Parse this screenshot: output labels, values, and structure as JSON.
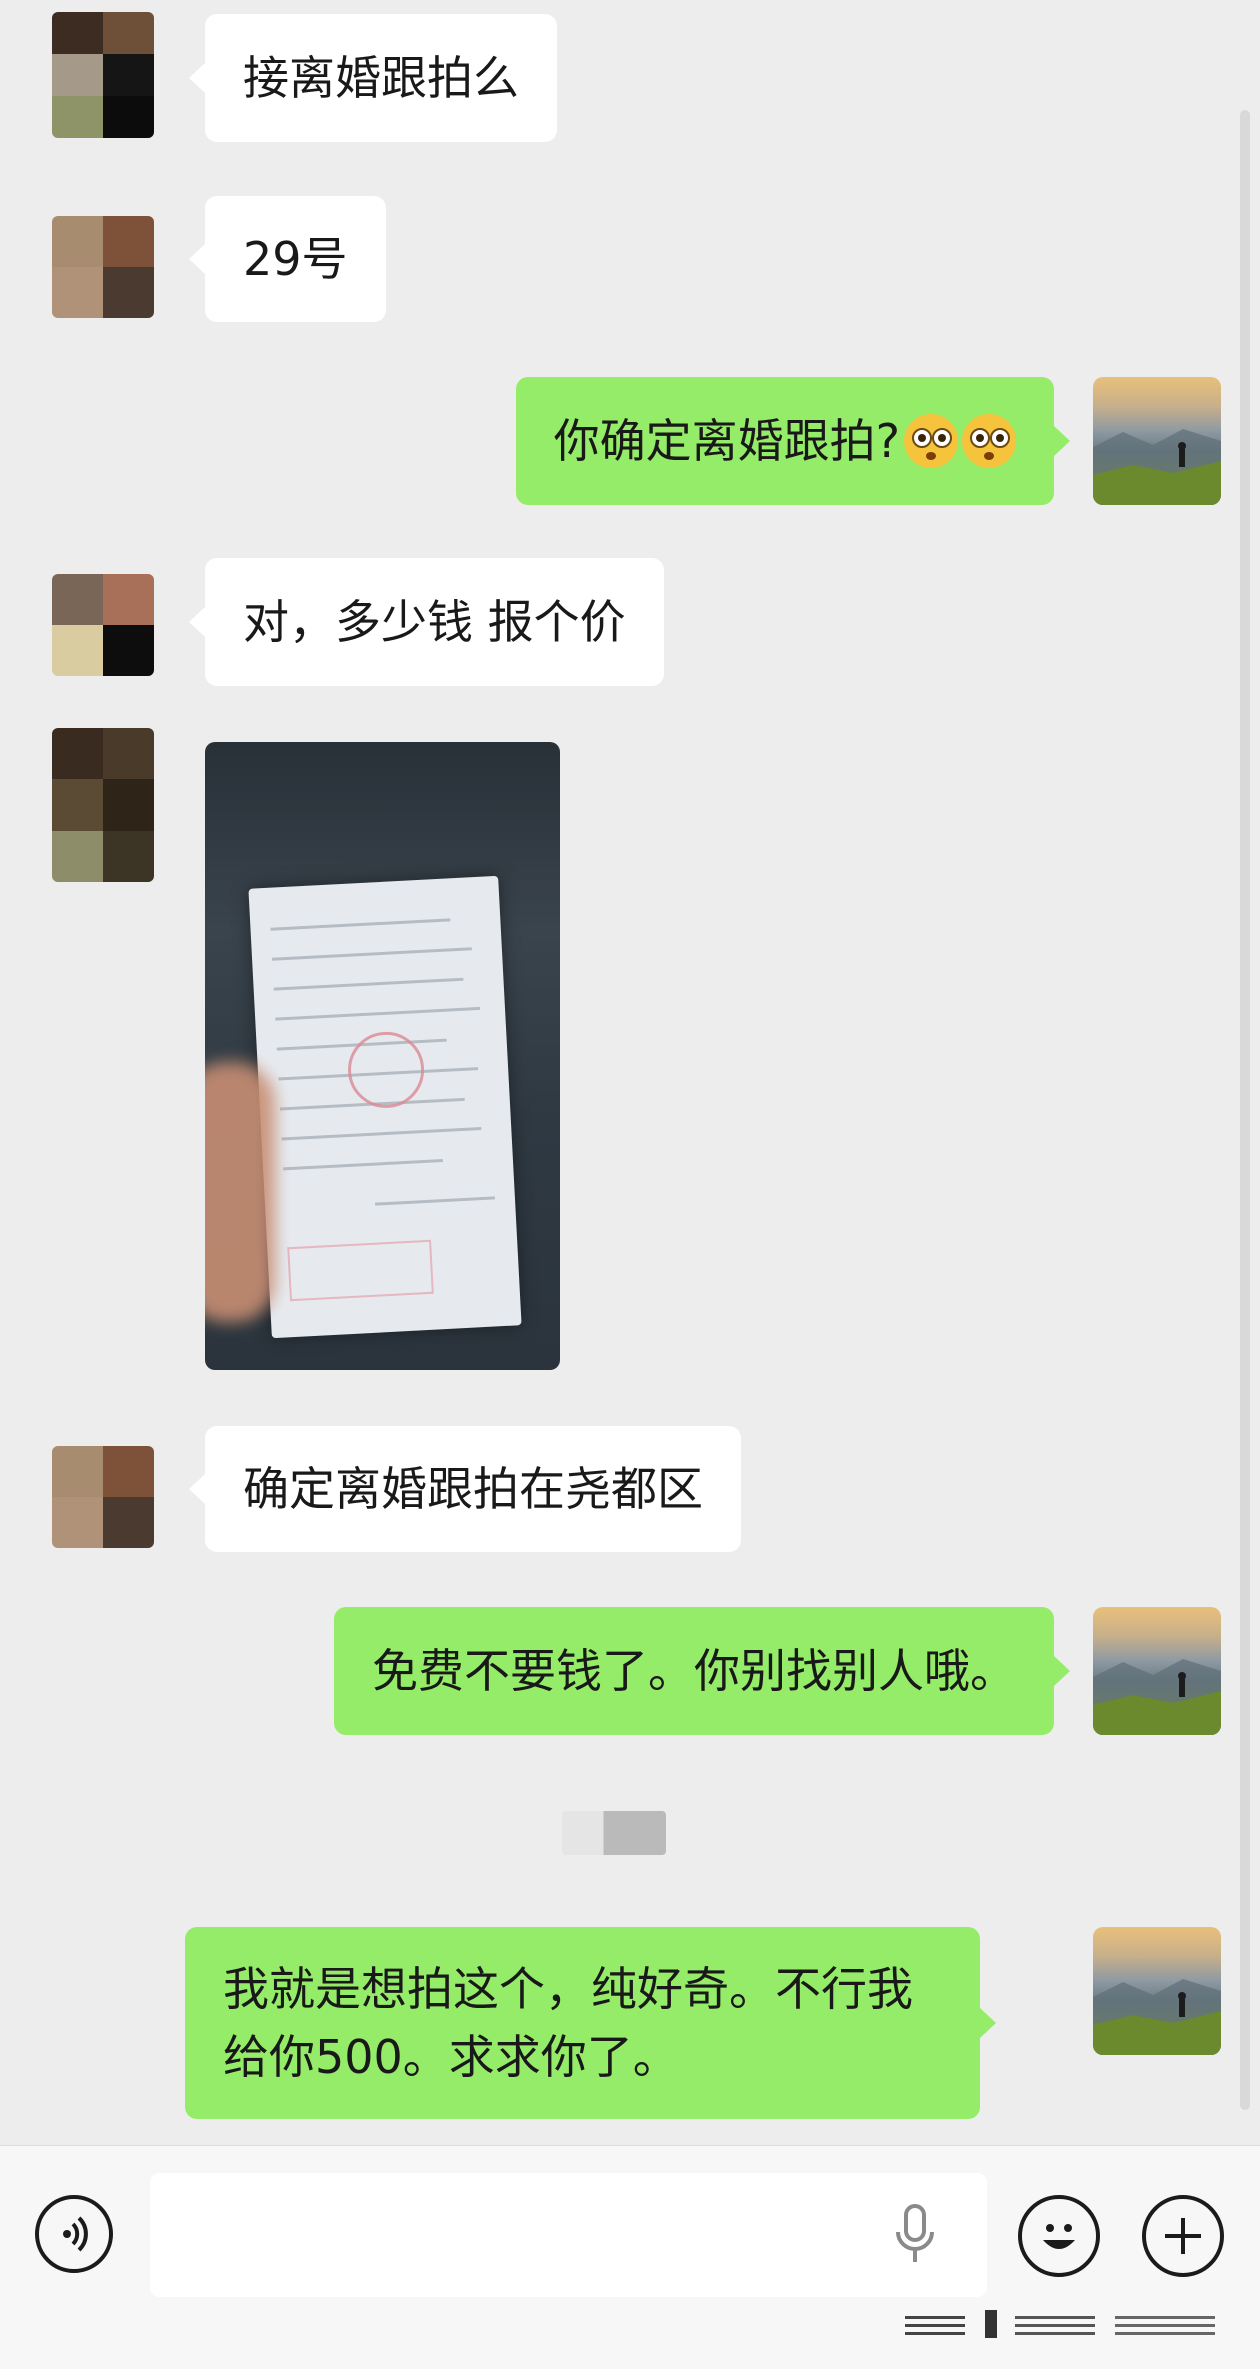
{
  "colors": {
    "background": "#ededed",
    "incoming_bubble": "#ffffff",
    "outgoing_bubble": "#95ec69"
  },
  "messages": [
    {
      "side": "in",
      "text": "接离婚跟拍么"
    },
    {
      "side": "in",
      "text": "29号"
    },
    {
      "side": "out",
      "text": "你确定离婚跟拍?",
      "emoji": "flushed-face-icon"
    },
    {
      "side": "in",
      "text": "对，多少钱 报个价"
    },
    {
      "side": "in",
      "type": "image",
      "image": "blurred-document-photo"
    },
    {
      "side": "in",
      "text": "确定离婚跟拍在尧都区"
    },
    {
      "side": "out",
      "text": "免费不要钱了。你别找别人哦。"
    },
    {
      "side": "out",
      "text": "我就是想拍这个，纯好奇。不行我给你500。求求你了。"
    }
  ],
  "input_bar": {
    "voice_icon": "voice-mode-icon",
    "mic_icon": "microphone-icon",
    "emoji_icon": "emoji-icon",
    "plus_icon": "plus-icon"
  }
}
